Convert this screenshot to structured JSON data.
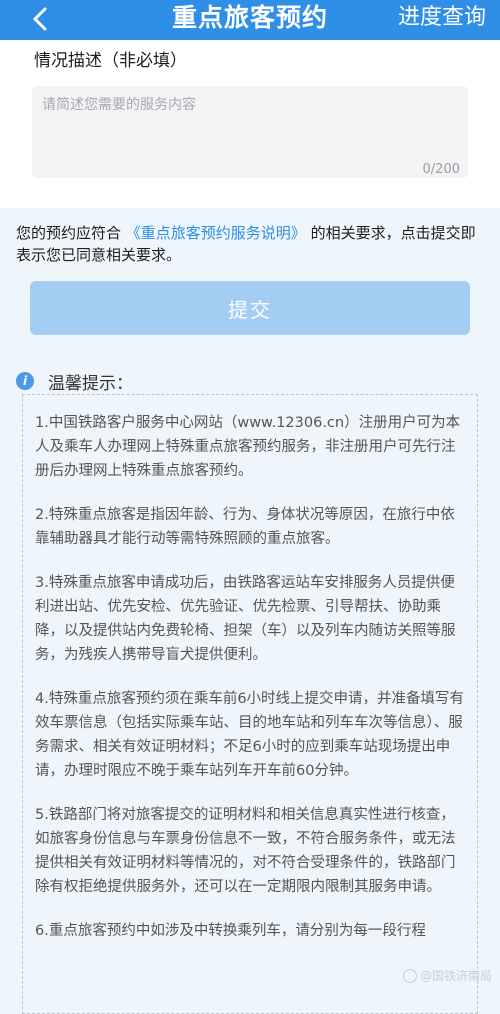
{
  "header": {
    "title": "重点旅客预约",
    "progress_label": "进度查询",
    "back_icon": "chevron-left-icon"
  },
  "form": {
    "field_label": "情况描述（非必填）",
    "placeholder": "请简述您需要的服务内容",
    "value": "",
    "counter": "0/200"
  },
  "agreement": {
    "prefix": "您的预约应符合",
    "link": "《重点旅客预约服务说明》",
    "suffix": "的相关要求，点击提交即表示您已同意相关要求。"
  },
  "submit_label": "提交",
  "tips": {
    "title": "温馨提示：",
    "items": [
      "1.中国铁路客户服务中心网站（www.12306.cn）注册用户可为本人及乘车人办理网上特殊重点旅客预约服务，非注册用户可先行注册后办理网上特殊重点旅客预约。",
      "2.特殊重点旅客是指因年龄、行为、身体状况等原因，在旅行中依靠辅助器具才能行动等需特殊照顾的重点旅客。",
      "3.特殊重点旅客申请成功后，由铁路客运站车安排服务人员提供便利进出站、优先安检、优先验证、优先检票、引导帮扶、协助乘降，以及提供站内免费轮椅、担架（车）以及列车内随访关照等服务，为残疾人携带导盲犬提供便利。",
      "4.特殊重点旅客预约须在乘车前6小时线上提交申请，并准备填写有效车票信息（包括实际乘车站、目的地车站和列车车次等信息）、服务需求、相关有效证明材料；不足6小时的应到乘车站现场提出申请，办理时限应不晚于乘车站列车开车前60分钟。",
      "5.铁路部门将对旅客提交的证明材料和相关信息真实性进行核查，如旅客身份信息与车票身份信息不一致，不符合服务条件，或无法提供相关有效证明材料等情况的，对不符合受理条件的，铁路部门除有权拒绝提供服务外，还可以在一定期限内限制其服务申请。",
      "6.重点旅客预约中如涉及中转换乘列车，请分别为每一段行程"
    ]
  },
  "watermark": "@国铁济南局"
}
